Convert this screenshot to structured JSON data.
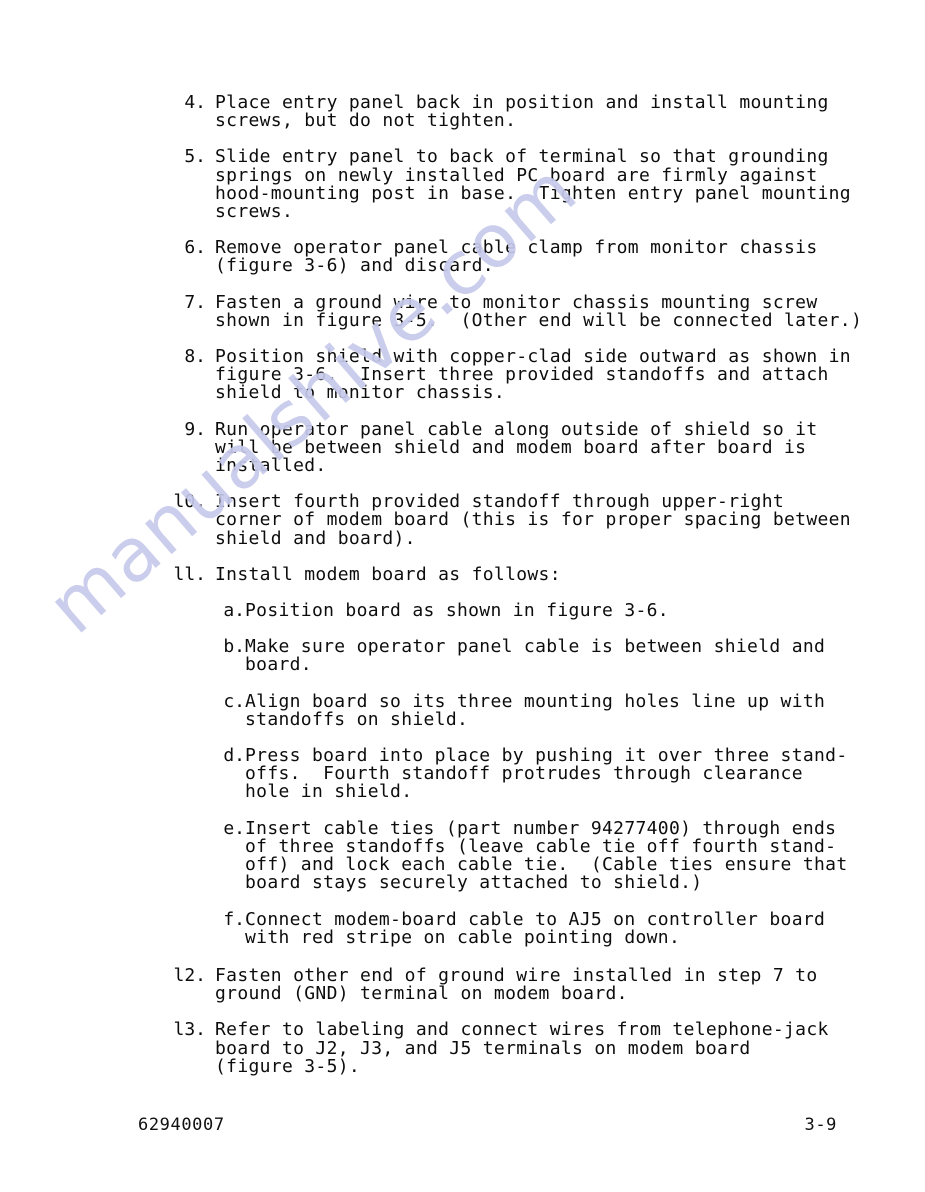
{
  "document": {
    "watermark": "manualshive.com",
    "watermark_color": "#c6c9ea",
    "text_color": "#0d0d0d",
    "background_color": "#ffffff"
  },
  "steps": [
    {
      "marker": "4.",
      "lines": "Place entry panel back in position and install mounting\nscrews, but do not tighten."
    },
    {
      "marker": "5.",
      "lines": "Slide entry panel to back of terminal so that grounding\nsprings on newly installed PC board are firmly against\nhood-mounting post in base.  Tighten entry panel mounting\nscrews."
    },
    {
      "marker": "6.",
      "lines": "Remove operator panel cable clamp from monitor chassis\n(figure 3-6) and discard."
    },
    {
      "marker": "7.",
      "lines": "Fasten a ground wire to monitor chassis mounting screw\nshown in figure 3-5.  (Other end will be connected later.)"
    },
    {
      "marker": "8.",
      "lines": "Position shield with copper-clad side outward as shown in\nfigure 3-6.  Insert three provided standoffs and attach\nshield to monitor chassis."
    },
    {
      "marker": "9.",
      "lines": "Run operator panel cable along outside of shield so it\nwill be between shield and modem board after board is\ninstalled."
    },
    {
      "marker": "l0.",
      "lines": "Insert fourth provided standoff through upper-right\ncorner of modem board (this is for proper spacing between\nshield and board)."
    },
    {
      "marker": "ll.",
      "lines": "Install modem board as follows:"
    },
    {
      "marker": "l2.",
      "lines": "Fasten other end of ground wire installed in step 7 to\nground (GND) terminal on modem board."
    },
    {
      "marker": "l3.",
      "lines": "Refer to labeling and connect wires from telephone-jack\nboard to J2, J3, and J5 terminals on modem board\n(figure 3-5)."
    }
  ],
  "substeps": [
    {
      "marker": "a.",
      "lines": "Position board as shown in figure 3-6."
    },
    {
      "marker": "b.",
      "lines": "Make sure operator panel cable is between shield and\nboard."
    },
    {
      "marker": "c.",
      "lines": "Align board so its three mounting holes line up with\nstandoffs on shield."
    },
    {
      "marker": "d.",
      "lines": "Press board into place by pushing it over three stand-\noffs.  Fourth standoff protrudes through clearance\nhole in shield."
    },
    {
      "marker": "e.",
      "lines": "Insert cable ties (part number 94277400) through ends\nof three standoffs (leave cable tie off fourth stand-\noff) and lock each cable tie.  (Cable ties ensure that\nboard stays securely attached to shield.)"
    },
    {
      "marker": "f.",
      "lines": "Connect modem-board cable to AJ5 on controller board\nwith red stripe on cable pointing down."
    }
  ],
  "footer": {
    "document_number": "62940007",
    "page_number": "3-9"
  }
}
